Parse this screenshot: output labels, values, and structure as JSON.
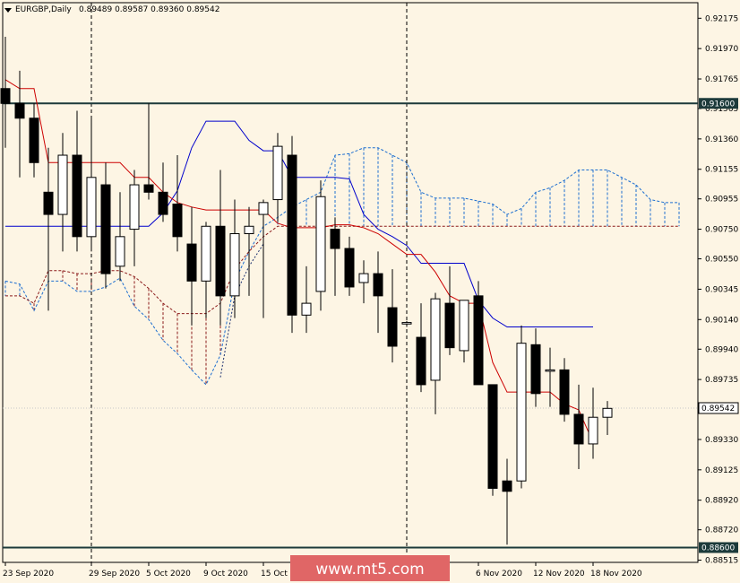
{
  "header": {
    "symbol": "EURGBP,Daily",
    "ohlc": "0.89489 0.89587 0.89360 0.89542"
  },
  "watermark": {
    "text": "www.mt5.com"
  },
  "colors": {
    "background": "#fdf5e4",
    "candle_up_fill": "#ffffff",
    "candle_down_fill": "#000000",
    "tenkan": "#cc0000",
    "kijun": "#0000cc",
    "senkou_a": "#1e6fd0",
    "senkou_b": "#8b1a1a",
    "level_line": "#1c3a3a",
    "watermark_bg": "#e06666"
  },
  "chart_data": {
    "type": "candlestick",
    "symbol": "EURGBP",
    "timeframe": "Daily",
    "indicator": "Ichimoku",
    "ylim": [
      0.885,
      0.9228
    ],
    "y_ticks": [
      "0.92175",
      "0.91970",
      "0.91765",
      "0.91565",
      "0.91360",
      "0.91155",
      "0.90955",
      "0.90750",
      "0.90550",
      "0.90345",
      "0.90140",
      "0.89940",
      "0.89735",
      "0.89535",
      "0.89330",
      "0.89125",
      "0.88920",
      "0.88720",
      "0.88515"
    ],
    "x_ticks": [
      "23 Sep 2020",
      "29 Sep 2020",
      "5 Oct 2020",
      "9 Oct 2020",
      "15 Oct 2020",
      "6 Nov 2020",
      "12 Nov 2020",
      "18 Nov 2020"
    ],
    "x_tick_index": [
      0,
      6,
      10,
      14,
      18,
      33,
      37,
      41
    ],
    "horizontal_levels": [
      {
        "label": "0.91600",
        "value": 0.916
      },
      {
        "label": "0.88600",
        "value": 0.886
      }
    ],
    "current_price_label": "0.89542",
    "current_price": 0.89542,
    "vertical_markers": [
      6,
      28
    ],
    "candles": [
      [
        0.917,
        0.9205,
        0.913,
        0.916
      ],
      [
        0.916,
        0.9182,
        0.911,
        0.915
      ],
      [
        0.915,
        0.916,
        0.911,
        0.912
      ],
      [
        0.91,
        0.913,
        0.902,
        0.9085
      ],
      [
        0.9085,
        0.914,
        0.906,
        0.9125
      ],
      [
        0.9125,
        0.9155,
        0.906,
        0.907
      ],
      [
        0.907,
        0.915,
        0.906,
        0.911
      ],
      [
        0.9105,
        0.912,
        0.9035,
        0.9045
      ],
      [
        0.905,
        0.91,
        0.904,
        0.907
      ],
      [
        0.9075,
        0.9115,
        0.905,
        0.9105
      ],
      [
        0.9105,
        0.916,
        0.9095,
        0.91
      ],
      [
        0.91,
        0.912,
        0.908,
        0.9085
      ],
      [
        0.9092,
        0.9125,
        0.906,
        0.907
      ],
      [
        0.9065,
        0.909,
        0.901,
        0.904
      ],
      [
        0.904,
        0.908,
        0.9015,
        0.9077
      ],
      [
        0.9077,
        0.9115,
        0.901,
        0.903
      ],
      [
        0.903,
        0.9095,
        0.9015,
        0.9072
      ],
      [
        0.9072,
        0.909,
        0.903,
        0.9077
      ],
      [
        0.9085,
        0.9095,
        0.9015,
        0.9093
      ],
      [
        0.9095,
        0.914,
        0.908,
        0.9131
      ],
      [
        0.9125,
        0.9138,
        0.9005,
        0.9017
      ],
      [
        0.9017,
        0.905,
        0.9005,
        0.9025
      ],
      [
        0.9033,
        0.9108,
        0.902,
        0.9097
      ],
      [
        0.9075,
        0.9083,
        0.903,
        0.9062
      ],
      [
        0.9062,
        0.907,
        0.903,
        0.9036
      ],
      [
        0.9039,
        0.9054,
        0.9025,
        0.9045
      ],
      [
        0.9045,
        0.906,
        0.9005,
        0.903
      ],
      [
        0.9022,
        0.9048,
        0.8985,
        0.8996
      ],
      [
        0.9011,
        0.9013,
        0.9009,
        0.9012
      ],
      [
        0.9002,
        0.9025,
        0.8965,
        0.897
      ],
      [
        0.8973,
        0.9032,
        0.895,
        0.9028
      ],
      [
        0.9025,
        0.905,
        0.899,
        0.8995
      ],
      [
        0.8993,
        0.902,
        0.8985,
        0.9027
      ],
      [
        0.903,
        0.904,
        0.897,
        0.897
      ],
      [
        0.897,
        0.896,
        0.8895,
        0.89
      ],
      [
        0.8905,
        0.892,
        0.8862,
        0.8898
      ],
      [
        0.8905,
        0.901,
        0.89,
        0.8998
      ],
      [
        0.8997,
        0.9008,
        0.8955,
        0.8964
      ],
      [
        0.898,
        0.8995,
        0.8955,
        0.898
      ],
      [
        0.898,
        0.8988,
        0.8945,
        0.895
      ],
      [
        0.895,
        0.897,
        0.8913,
        0.893
      ],
      [
        0.893,
        0.8968,
        0.892,
        0.8948
      ],
      [
        0.8948,
        0.8959,
        0.8936,
        0.8954
      ]
    ],
    "tenkan_sen": [
      [
        0,
        0.9176
      ],
      [
        1,
        0.917
      ],
      [
        2,
        0.917
      ],
      [
        3,
        0.912
      ],
      [
        4,
        0.912
      ],
      [
        5,
        0.912
      ],
      [
        6,
        0.912
      ],
      [
        7,
        0.912
      ],
      [
        8,
        0.912
      ],
      [
        9,
        0.911
      ],
      [
        10,
        0.911
      ],
      [
        11,
        0.91
      ],
      [
        12,
        0.9093
      ],
      [
        13,
        0.909
      ],
      [
        14,
        0.9088
      ],
      [
        15,
        0.9088
      ],
      [
        16,
        0.9088
      ],
      [
        17,
        0.9088
      ],
      [
        18,
        0.9088
      ],
      [
        19,
        0.9079
      ],
      [
        20,
        0.9076
      ],
      [
        21,
        0.9076
      ],
      [
        22,
        0.9076
      ],
      [
        23,
        0.9078
      ],
      [
        24,
        0.9078
      ],
      [
        25,
        0.9076
      ],
      [
        26,
        0.9072
      ],
      [
        27,
        0.9065
      ],
      [
        28,
        0.9058
      ],
      [
        29,
        0.9058
      ],
      [
        30,
        0.9046
      ],
      [
        31,
        0.903
      ],
      [
        32,
        0.9025
      ],
      [
        33,
        0.9025
      ],
      [
        34,
        0.8985
      ],
      [
        35,
        0.8965
      ],
      [
        36,
        0.8965
      ],
      [
        37,
        0.8965
      ],
      [
        38,
        0.8965
      ],
      [
        39,
        0.8957
      ],
      [
        40,
        0.8953
      ],
      [
        41,
        0.8931
      ]
    ],
    "kijun_sen": [
      [
        0,
        0.9077
      ],
      [
        6,
        0.9077
      ],
      [
        10,
        0.9077
      ],
      [
        11,
        0.9086
      ],
      [
        12,
        0.9101
      ],
      [
        13,
        0.913
      ],
      [
        14,
        0.9148
      ],
      [
        15,
        0.9148
      ],
      [
        16,
        0.9148
      ],
      [
        17,
        0.9135
      ],
      [
        18,
        0.9128
      ],
      [
        19,
        0.9128
      ],
      [
        20,
        0.911
      ],
      [
        21,
        0.911
      ],
      [
        22,
        0.911
      ],
      [
        23,
        0.911
      ],
      [
        24,
        0.9109
      ],
      [
        25,
        0.9085
      ],
      [
        26,
        0.9075
      ],
      [
        27,
        0.907
      ],
      [
        28,
        0.9064
      ],
      [
        29,
        0.9052
      ],
      [
        30,
        0.9052
      ],
      [
        31,
        0.9052
      ],
      [
        32,
        0.9052
      ],
      [
        33,
        0.9027
      ],
      [
        34,
        0.9015
      ],
      [
        35,
        0.9009
      ],
      [
        36,
        0.9009
      ],
      [
        37,
        0.9009
      ],
      [
        38,
        0.9009
      ],
      [
        39,
        0.9009
      ],
      [
        40,
        0.9009
      ],
      [
        41,
        0.9009
      ]
    ],
    "senkou_span_a": [
      [
        0,
        0.904
      ],
      [
        1,
        0.9038
      ],
      [
        2,
        0.902
      ],
      [
        3,
        0.904
      ],
      [
        4,
        0.904
      ],
      [
        5,
        0.9033
      ],
      [
        6,
        0.9033
      ],
      [
        7,
        0.9036
      ],
      [
        8,
        0.9042
      ],
      [
        9,
        0.9023
      ],
      [
        10,
        0.9014
      ],
      [
        11,
        0.9
      ],
      [
        12,
        0.8991
      ],
      [
        13,
        0.898
      ],
      [
        14,
        0.897
      ],
      [
        15,
        0.899
      ],
      [
        16,
        0.904
      ],
      [
        17,
        0.906
      ],
      [
        18,
        0.9077
      ],
      [
        19,
        0.9083
      ],
      [
        20,
        0.909
      ],
      [
        21,
        0.9095
      ],
      [
        22,
        0.91
      ],
      [
        23,
        0.9125
      ],
      [
        24,
        0.9126
      ],
      [
        25,
        0.913
      ],
      [
        26,
        0.913
      ],
      [
        27,
        0.9125
      ],
      [
        28,
        0.912
      ],
      [
        29,
        0.91
      ],
      [
        30,
        0.9096
      ],
      [
        31,
        0.9096
      ],
      [
        32,
        0.9096
      ],
      [
        33,
        0.9094
      ],
      [
        34,
        0.9092
      ],
      [
        35,
        0.9085
      ],
      [
        36,
        0.9089
      ],
      [
        37,
        0.91
      ],
      [
        38,
        0.9103
      ],
      [
        39,
        0.9108
      ],
      [
        40,
        0.9115
      ],
      [
        41,
        0.9115
      ],
      [
        42,
        0.9115
      ],
      [
        43,
        0.911
      ],
      [
        44,
        0.9105
      ],
      [
        45,
        0.9095
      ],
      [
        46,
        0.9093
      ],
      [
        47,
        0.9093
      ]
    ],
    "senkou_span_b": [
      [
        0,
        0.903
      ],
      [
        1,
        0.903
      ],
      [
        2,
        0.9025
      ],
      [
        3,
        0.9047
      ],
      [
        4,
        0.9047
      ],
      [
        5,
        0.9045
      ],
      [
        6,
        0.9045
      ],
      [
        7,
        0.9047
      ],
      [
        8,
        0.9047
      ],
      [
        9,
        0.9043
      ],
      [
        10,
        0.9035
      ],
      [
        11,
        0.9025
      ],
      [
        12,
        0.9018
      ],
      [
        13,
        0.9018
      ],
      [
        14,
        0.9018
      ],
      [
        15,
        0.9025
      ],
      [
        16,
        0.9048
      ],
      [
        17,
        0.906
      ],
      [
        18,
        0.907
      ],
      [
        19,
        0.9077
      ],
      [
        20,
        0.9077
      ],
      [
        21,
        0.9077
      ],
      [
        22,
        0.9077
      ],
      [
        23,
        0.9077
      ],
      [
        24,
        0.9077
      ],
      [
        25,
        0.9077
      ],
      [
        26,
        0.9077
      ],
      [
        27,
        0.9077
      ],
      [
        28,
        0.9077
      ],
      [
        29,
        0.9077
      ],
      [
        30,
        0.9077
      ],
      [
        31,
        0.9077
      ],
      [
        32,
        0.9077
      ],
      [
        33,
        0.9077
      ],
      [
        34,
        0.9077
      ],
      [
        35,
        0.9077
      ],
      [
        36,
        0.9077
      ],
      [
        37,
        0.9077
      ],
      [
        38,
        0.9077
      ],
      [
        39,
        0.9077
      ],
      [
        40,
        0.9077
      ],
      [
        41,
        0.9077
      ],
      [
        42,
        0.9077
      ],
      [
        43,
        0.9077
      ],
      [
        44,
        0.9077
      ],
      [
        45,
        0.9077
      ],
      [
        46,
        0.9077
      ],
      [
        47,
        0.9077
      ]
    ],
    "chikou_span": [
      [
        15,
        0.8975
      ],
      [
        16,
        0.903
      ],
      [
        17,
        0.905
      ],
      [
        18,
        0.9065
      ]
    ]
  }
}
